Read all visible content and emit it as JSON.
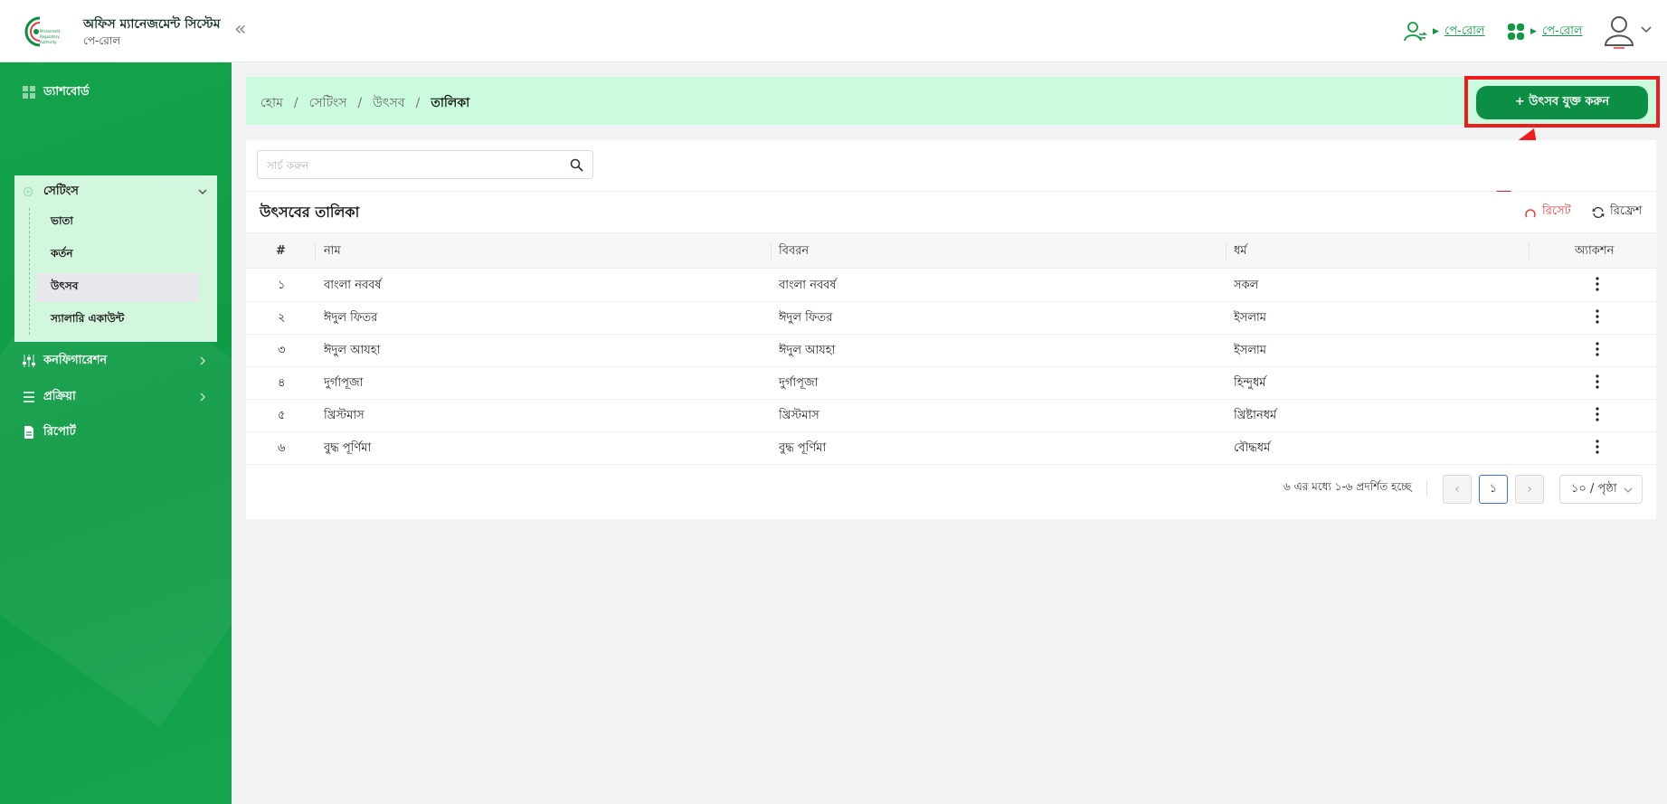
{
  "header": {
    "brand_title": "অফিস ম্যানেজমেন্ট সিস্টেম",
    "brand_sub": "পে-রোল",
    "collapse_glyph": "«",
    "switch_user_label": "পে-রোল",
    "switch_module_label": "পে-রোল"
  },
  "sidebar": {
    "dashboard": "ড্যাশবোর্ড",
    "settings": "সেটিংস",
    "settings_items": [
      "ভাতা",
      "কর্তন",
      "উৎসব",
      "স্যালারি একাউন্ট"
    ],
    "configuration": "কনফিগারেশন",
    "process": "প্রক্রিয়া",
    "report": "রিপোর্ট"
  },
  "breadcrumb": {
    "items": [
      "হোম",
      "সেটিংস",
      "উৎসব",
      "তালিকা"
    ],
    "separator": "/"
  },
  "add_button": "+ উৎসব যুক্ত করুন",
  "search": {
    "placeholder": "সার্চ করুন",
    "value": ""
  },
  "table": {
    "title": "উৎসবের তালিকা",
    "reset": "রিসেট",
    "refresh": "রিফ্রেশ",
    "columns": [
      "#",
      "নাম",
      "বিবরন",
      "ধর্ম",
      "অ্যাকশন"
    ],
    "rows": [
      [
        "১",
        "বাংলা নববর্ষ",
        "বাংলা নববর্ষ",
        "সকল"
      ],
      [
        "২",
        "ঈদুল ফিতর",
        "ঈদুল ফিতর",
        "ইসলাম"
      ],
      [
        "৩",
        "ঈদুল আযহা",
        "ঈদুল আযহা",
        "ইসলাম"
      ],
      [
        "৪",
        "দুর্গাপূজা",
        "দুর্গাপূজা",
        "হিন্দুধর্ম"
      ],
      [
        "৫",
        "খ্রিস্টমাস",
        "খ্রিস্টমাস",
        "খ্রিষ্টানধর্ম"
      ],
      [
        "৬",
        "বুদ্ধ পূর্ণিমা",
        "বুদ্ধ পূর্ণিমা",
        "বৌদ্ধধর্ম"
      ]
    ]
  },
  "pagination": {
    "info": "৬ এর মধ্যে ১-৬ প্রদর্শিত হচ্ছে",
    "prev": "‹",
    "next": "›",
    "current_page": "১",
    "page_size": "১০ / পৃষ্ঠা"
  },
  "colors": {
    "brand_green": "#0c8f44",
    "sidebar_green": "#14a34c",
    "highlight_red": "#ee1c1c",
    "breadcrumb_bg": "#cbfbde"
  }
}
